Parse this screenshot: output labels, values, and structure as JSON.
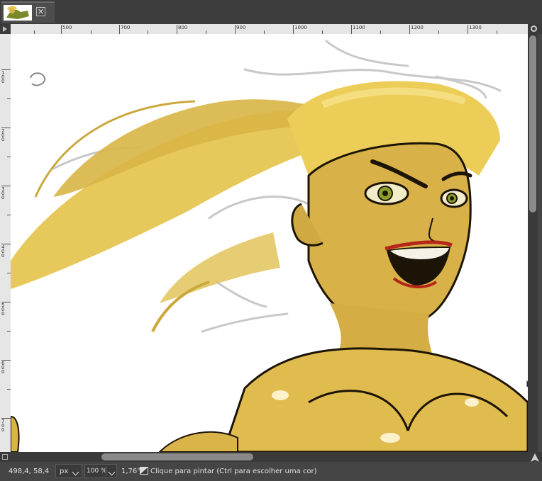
{
  "tab": {
    "thumbnail_icon": "image-thumbnail",
    "close_icon": "close-icon"
  },
  "ruler": {
    "h_labels": [
      "500",
      "700",
      "800",
      "900",
      "1000",
      "1100",
      "1200",
      "1300"
    ],
    "v_labels": [
      "100",
      "200",
      "300",
      "400",
      "500",
      "600",
      "700"
    ]
  },
  "status": {
    "coordinates": "498,4, 58,4",
    "unit": "px",
    "zoom": "100 %",
    "angle": "1,76°",
    "message": "Clique para pintar (Ctrl para escolher uma cor)"
  },
  "colors": {
    "hair": "#e8c84a",
    "skin": "#d9b44a",
    "outline": "#1c1406",
    "lips": "#b5261a",
    "eyes": "#8aa02a"
  }
}
